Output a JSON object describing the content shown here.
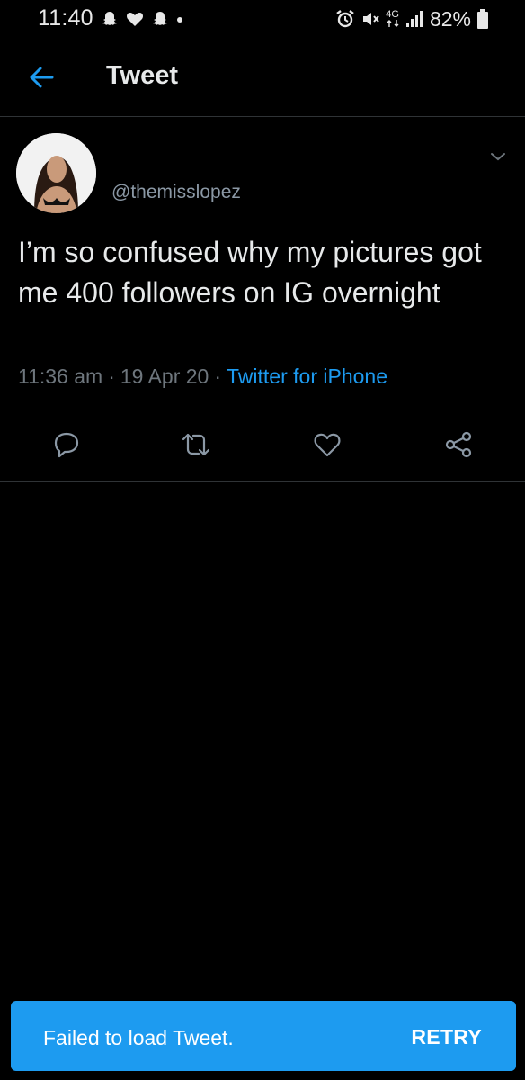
{
  "status_bar": {
    "time": "11:40",
    "battery": "82%",
    "network": "4G",
    "icons": [
      "snapchat-icon",
      "heart-icon",
      "snapchat-icon",
      "dot-icon",
      "alarm-icon",
      "mute-icon",
      "network-4g-icon",
      "signal-icon",
      "battery-icon"
    ]
  },
  "header": {
    "title": "Tweet",
    "back_icon": "back-arrow-icon"
  },
  "tweet": {
    "handle": "@themisslopez",
    "text": "I’m so confused why my pictures got me 400 followers on IG overnight",
    "time": "11:36 am",
    "date": "19 Apr 20",
    "source": "Twitter for iPhone",
    "separator": "·",
    "actions": [
      "reply-icon",
      "retweet-icon",
      "like-icon",
      "share-icon"
    ]
  },
  "snackbar": {
    "message": "Failed to load Tweet.",
    "action": "RETRY"
  },
  "colors": {
    "background": "#000000",
    "accent": "#1d9bf0",
    "text": "#e7e9ea",
    "muted": "#6e767d",
    "divider": "#2f3336"
  }
}
